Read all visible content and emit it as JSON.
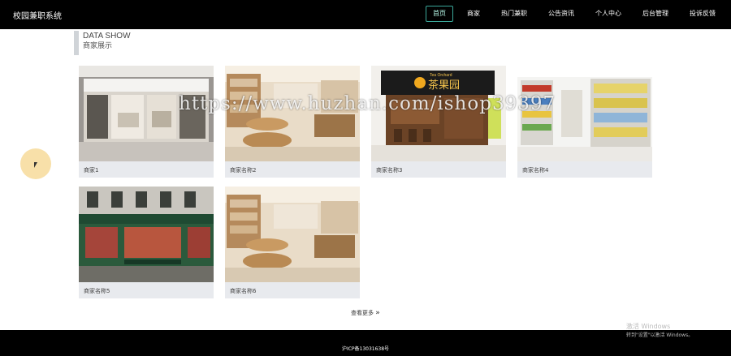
{
  "header": {
    "brand": "校园兼职系统",
    "nav": [
      {
        "label": "首页",
        "active": true
      },
      {
        "label": "商家",
        "active": false
      },
      {
        "label": "热门兼职",
        "active": false
      },
      {
        "label": "公告资讯",
        "active": false
      },
      {
        "label": "个人中心",
        "active": false
      },
      {
        "label": "后台管理",
        "active": false
      },
      {
        "label": "投诉反馈",
        "active": false
      }
    ]
  },
  "section": {
    "title_en": "DATA SHOW",
    "title_cn": "商家展示"
  },
  "cards": [
    {
      "name": "商家1",
      "image": "storefront-photo"
    },
    {
      "name": "商家名称2",
      "image": "store-interior-photo"
    },
    {
      "name": "商家名称3",
      "image": "tea-shop-photo"
    },
    {
      "name": "商家名称4",
      "image": "supermarket-shelves-photo"
    },
    {
      "name": "商家名称5",
      "image": "pastry-shop-photo"
    },
    {
      "name": "商家名称6",
      "image": "store-interior-photo"
    }
  ],
  "tea_sign": {
    "en": "Tea Orchard",
    "cn": "茶果园"
  },
  "more_label": "查看更多",
  "watermark": "https://www.huzhan.com/ishop39397",
  "footer": {
    "icp": "沪ICP备13031638号"
  },
  "windows_activation": {
    "title": "激活 Windows",
    "subtitle": "转到\"设置\"以激活 Windows。"
  }
}
